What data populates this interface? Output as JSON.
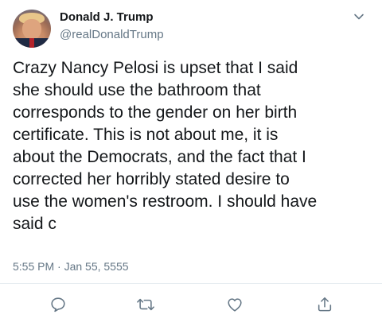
{
  "author": {
    "name": "Donald J. Trump",
    "handle": "@realDonaldTrump"
  },
  "tweet": {
    "text": "Crazy Nancy Pelosi is upset that I said\nshe should use the bathroom that\ncorresponds to the gender on her birth\ncertificate. This is not about me, it is\nabout the Democrats, and the fact that I\ncorrected her horribly stated desire to\nuse the women's restroom. I should have\nsaid c",
    "timestamp": "5:55 PM · Jan 55, 5555"
  },
  "icons": {
    "menu": "chevron-down-icon",
    "reply": "reply-icon",
    "retweet": "retweet-icon",
    "like": "heart-icon",
    "share": "share-icon"
  },
  "colors": {
    "text": "#14171a",
    "secondary": "#657786",
    "icon": "#657786",
    "divider": "#e6ecf0"
  }
}
